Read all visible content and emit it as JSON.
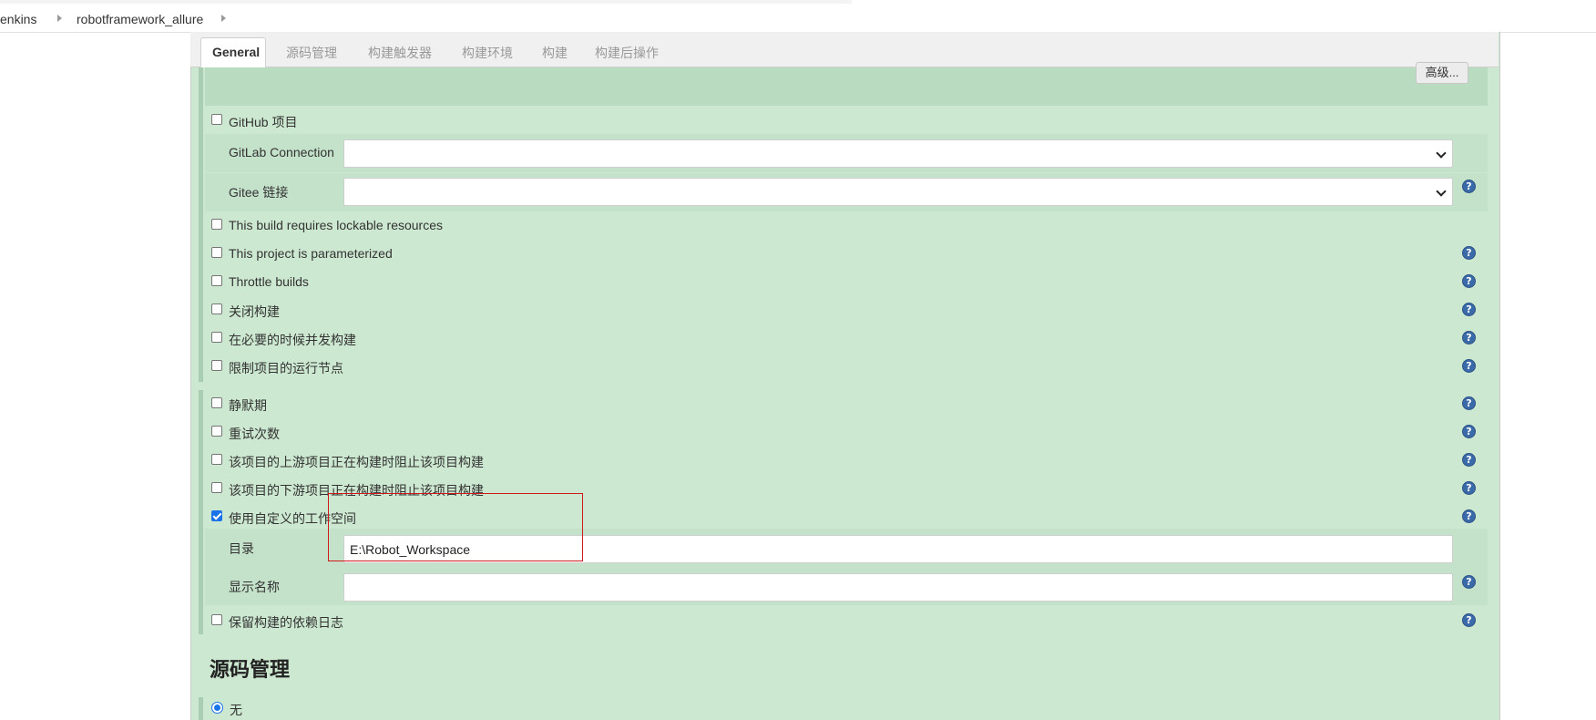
{
  "breadcrumb": [
    "enkins",
    "robotframework_allure"
  ],
  "tabs": [
    "General",
    "源码管理",
    "构建触发器",
    "构建环境",
    "构建",
    "构建后操作"
  ],
  "advanced_button": "高级...",
  "github_project": "GitHub 项目",
  "gitlab_connection_label": "GitLab Connection",
  "gitee_link_label": "Gitee 链接",
  "options_group1": [
    "This build requires lockable resources",
    "This project is parameterized",
    "Throttle builds",
    "关闭构建",
    "在必要的时候并发构建",
    "限制项目的运行节点"
  ],
  "options_group2": [
    "静默期",
    "重试次数",
    "该项目的上游项目正在构建时阻止该项目构建",
    "该项目的下游项目正在构建时阻止该项目构建"
  ],
  "custom_workspace": {
    "label": "使用自定义的工作空间",
    "checked": true,
    "directory_label": "目录",
    "directory_value": "E:\\Robot_Workspace",
    "display_name_label": "显示名称",
    "display_name_value": ""
  },
  "keep_dependency_log": "保留构建的依赖日志",
  "scm_heading": "源码管理",
  "scm_option_none": "无",
  "help_icon_glyph": "?",
  "colors": {
    "panel_bg": "#cce8d0",
    "highlight_box": "#d0191b",
    "help_icon": "#3b6aa8",
    "checkbox_checked": "#1a73e8"
  }
}
